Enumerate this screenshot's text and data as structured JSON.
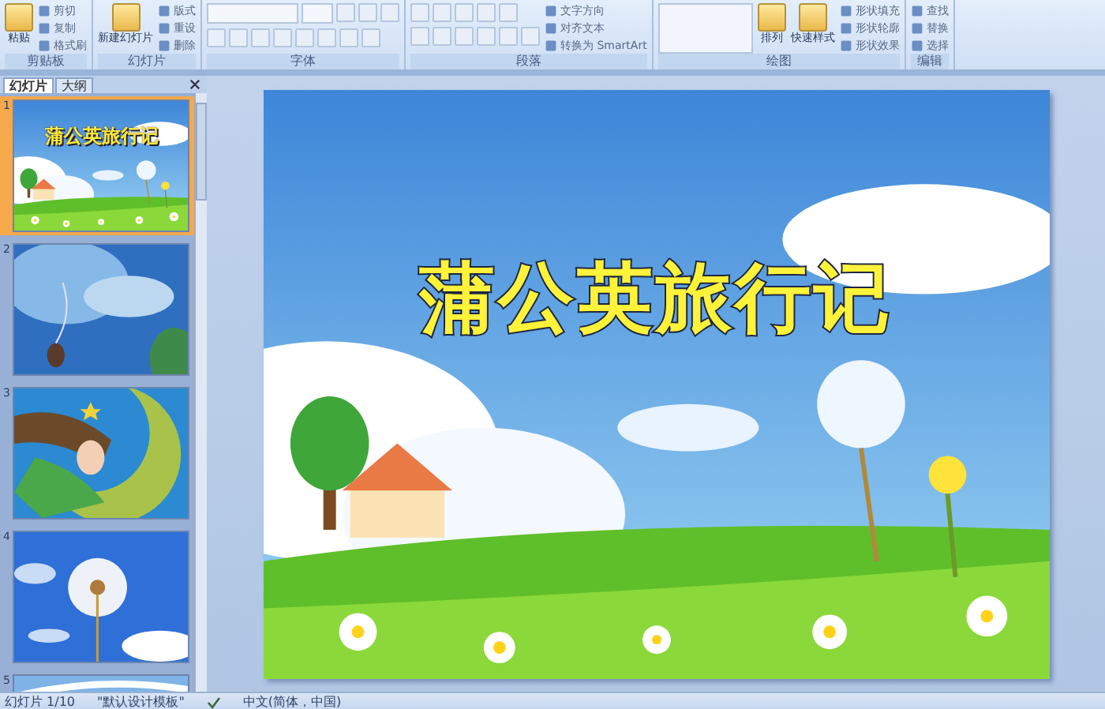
{
  "ribbon": {
    "groups": [
      {
        "label": "剪贴板",
        "items": [
          {
            "kind": "large",
            "label": "粘贴"
          },
          {
            "kind": "small",
            "label": "剪切"
          },
          {
            "kind": "small",
            "label": "复制"
          },
          {
            "kind": "small",
            "label": "格式刷"
          }
        ]
      },
      {
        "label": "幻灯片",
        "items": [
          {
            "kind": "large",
            "label": "新建幻灯片"
          },
          {
            "kind": "small",
            "label": "版式"
          },
          {
            "kind": "small",
            "label": "重设"
          },
          {
            "kind": "small",
            "label": "删除"
          }
        ]
      },
      {
        "label": "字体",
        "items": [
          {
            "kind": "font"
          }
        ]
      },
      {
        "label": "段落",
        "items": [
          {
            "kind": "para"
          },
          {
            "kind": "small",
            "label": "文字方向"
          },
          {
            "kind": "small",
            "label": "对齐文本"
          },
          {
            "kind": "small",
            "label": "转换为 SmartArt"
          }
        ]
      },
      {
        "label": "绘图",
        "items": [
          {
            "kind": "shapes"
          },
          {
            "kind": "large",
            "label": "排列"
          },
          {
            "kind": "large",
            "label": "快速样式"
          },
          {
            "kind": "small",
            "label": "形状填充"
          },
          {
            "kind": "small",
            "label": "形状轮廓"
          },
          {
            "kind": "small",
            "label": "形状效果"
          }
        ]
      },
      {
        "label": "编辑",
        "items": [
          {
            "kind": "small",
            "label": "查找"
          },
          {
            "kind": "small",
            "label": "替换"
          },
          {
            "kind": "small",
            "label": "选择"
          }
        ]
      }
    ]
  },
  "panel": {
    "tabs": [
      {
        "label": "幻灯片",
        "selected": true
      },
      {
        "label": "大纲",
        "selected": false
      }
    ],
    "slides": [
      {
        "number": "1",
        "selected": true,
        "title": "蒲公英旅行记"
      },
      {
        "number": "2",
        "selected": false
      },
      {
        "number": "3",
        "selected": false
      },
      {
        "number": "4",
        "selected": false
      },
      {
        "number": "5",
        "selected": false
      }
    ]
  },
  "slide": {
    "title": "蒲公英旅行记"
  },
  "status_bar": {
    "slide": "幻灯片 1/10",
    "theme": "\"默认设计模板\"",
    "language": "中文(简体，中国)"
  }
}
